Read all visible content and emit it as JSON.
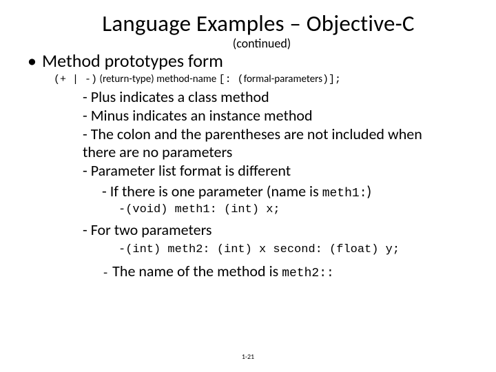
{
  "title": "Language Examples – Objective-C",
  "subtitle": "(continued)",
  "bullet1": "Method prototypes form",
  "syntax": {
    "a": "(+ | -)",
    "b": "(return-type) method-name",
    "c": "[: (",
    "d": "formal-parameters",
    "e": ")];"
  },
  "l2_1": "- Plus indicates a class method",
  "l2_2": "- Minus indicates an instance method",
  "l2_3": "- The colon and the parentheses are not included when there are no parameters",
  "l2_4": "- Parameter list format is different",
  "l3_1a": "- If there is one parameter (name is ",
  "l3_1b": "meth1:",
  "l3_1c": ")",
  "code1": "-(void) meth1: (int) x;",
  "l2_5": "- For two parameters",
  "code2": "-(int) meth2: (int) x second: (float) y;",
  "l3_2_dash": "-",
  "l3_2a": " The name of the method is ",
  "l3_2b": "meth2::",
  "footer": "1-21"
}
